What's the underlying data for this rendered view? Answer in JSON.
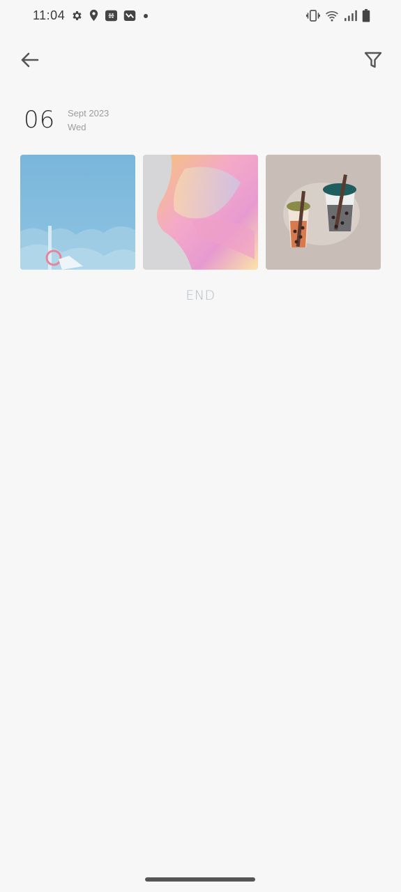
{
  "status_bar": {
    "time": "11:04",
    "left_icons": [
      "gear-icon",
      "location-icon",
      "link-icon",
      "message-icon",
      "dot-icon"
    ],
    "right_icons": [
      "vibrate-icon",
      "wifi-icon",
      "signal-icon",
      "battery-icon"
    ]
  },
  "toolbar": {
    "back_icon": "arrow-left-icon",
    "filter_icon": "funnel-icon"
  },
  "date_header": {
    "day": "06",
    "month_year": "Sept 2023",
    "weekday": "Wed"
  },
  "gallery": {
    "thumbnails": [
      {
        "name": "sky-wallpaper",
        "bg": "#7fb9dc"
      },
      {
        "name": "abstract-gradient-wallpaper",
        "bg": "#d4d4d6"
      },
      {
        "name": "bubble-tea-wallpaper",
        "bg": "#c9bfb8"
      }
    ]
  },
  "footer": {
    "end_label": "END"
  },
  "colors": {
    "background": "#f7f7f7",
    "text_primary": "#2e2e2e",
    "text_secondary": "#9c9c9c",
    "end_label": "#b4bcc6"
  }
}
